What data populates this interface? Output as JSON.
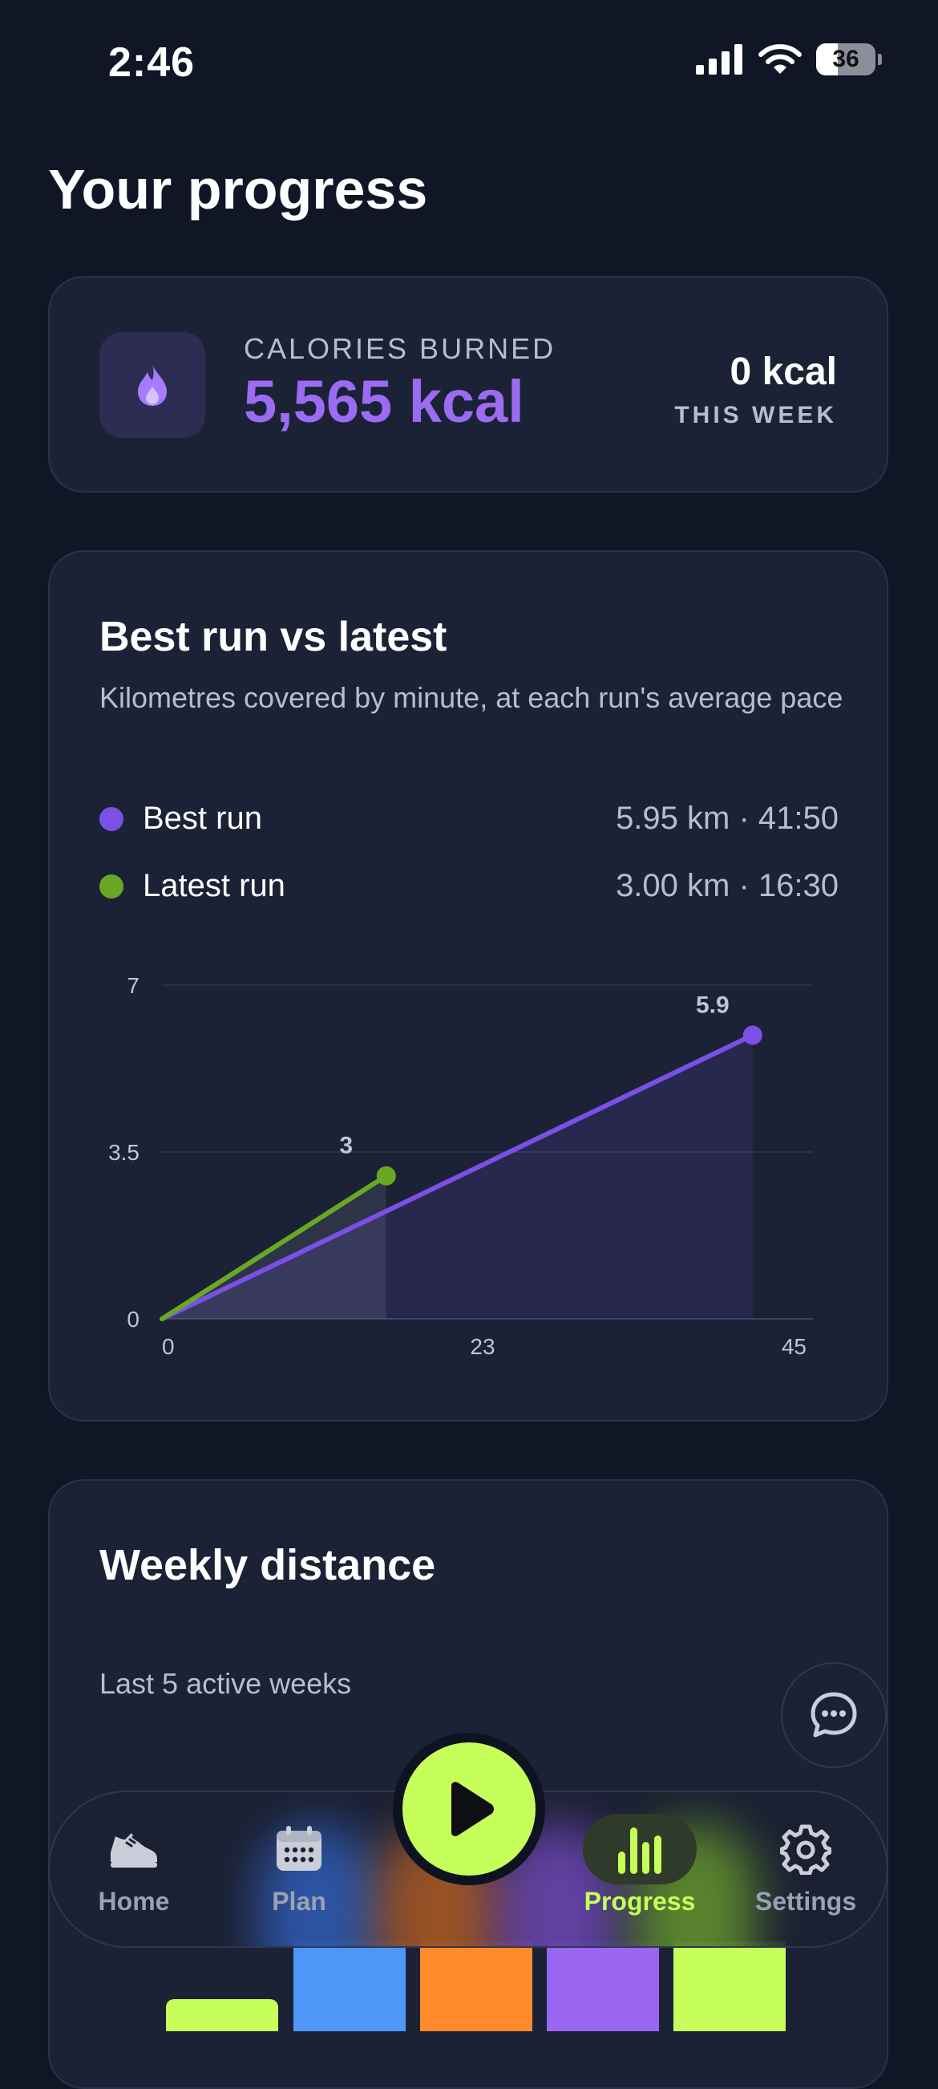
{
  "status_bar": {
    "time": "2:46",
    "battery": "36",
    "battery_level": 0.36
  },
  "page_title": "Your progress",
  "calories": {
    "label": "CALORIES BURNED",
    "value": "5,565 kcal",
    "week_value": "0 kcal",
    "week_label": "THIS WEEK",
    "icon": "flame-icon",
    "accent": "#9b6cf2"
  },
  "run_card": {
    "title": "Best run vs latest",
    "subtitle": "Kilometres covered by minute, at each run's average pace",
    "legend": [
      {
        "name": "Best run",
        "stat": "5.95 km · 41:50",
        "color": "#7b50e6"
      },
      {
        "name": "Latest run",
        "stat": "3.00 km · 16:30",
        "color": "#6aa824"
      }
    ]
  },
  "chart_data": {
    "type": "line",
    "title": "",
    "xlabel": "",
    "ylabel": "",
    "xlim": [
      0,
      45
    ],
    "ylim": [
      0,
      7
    ],
    "x_ticks": [
      0,
      23,
      45
    ],
    "y_ticks": [
      0,
      3.5,
      7
    ],
    "grid": true,
    "series": [
      {
        "name": "Best run",
        "color": "#7b50e6",
        "points": [
          [
            0,
            0
          ],
          [
            41.83,
            5.95
          ]
        ],
        "end_label": "5.9"
      },
      {
        "name": "Latest run",
        "color": "#6aa824",
        "points": [
          [
            0,
            0
          ],
          [
            16.5,
            3.0
          ]
        ],
        "end_label": "3"
      }
    ]
  },
  "weekly": {
    "title": "Weekly distance",
    "subtitle": "Last 5 active weeks",
    "bar_colors": [
      "#c6ff5a",
      "#4f97f7",
      "#ff8a2a",
      "#9a66f2",
      "#c6ff5a"
    ]
  },
  "chat_button": {
    "icon": "chat-icon"
  },
  "tab_bar": {
    "tabs": [
      {
        "label": "Home",
        "icon": "sneaker-icon",
        "active": false
      },
      {
        "label": "Plan",
        "icon": "calendar-icon",
        "active": false
      },
      {
        "label": "Progress",
        "icon": "bar-chart-icon",
        "active": true
      },
      {
        "label": "Settings",
        "icon": "gear-icon",
        "active": false
      }
    ],
    "center_button_icon": "play-icon",
    "accent": "#c6ff5a"
  }
}
